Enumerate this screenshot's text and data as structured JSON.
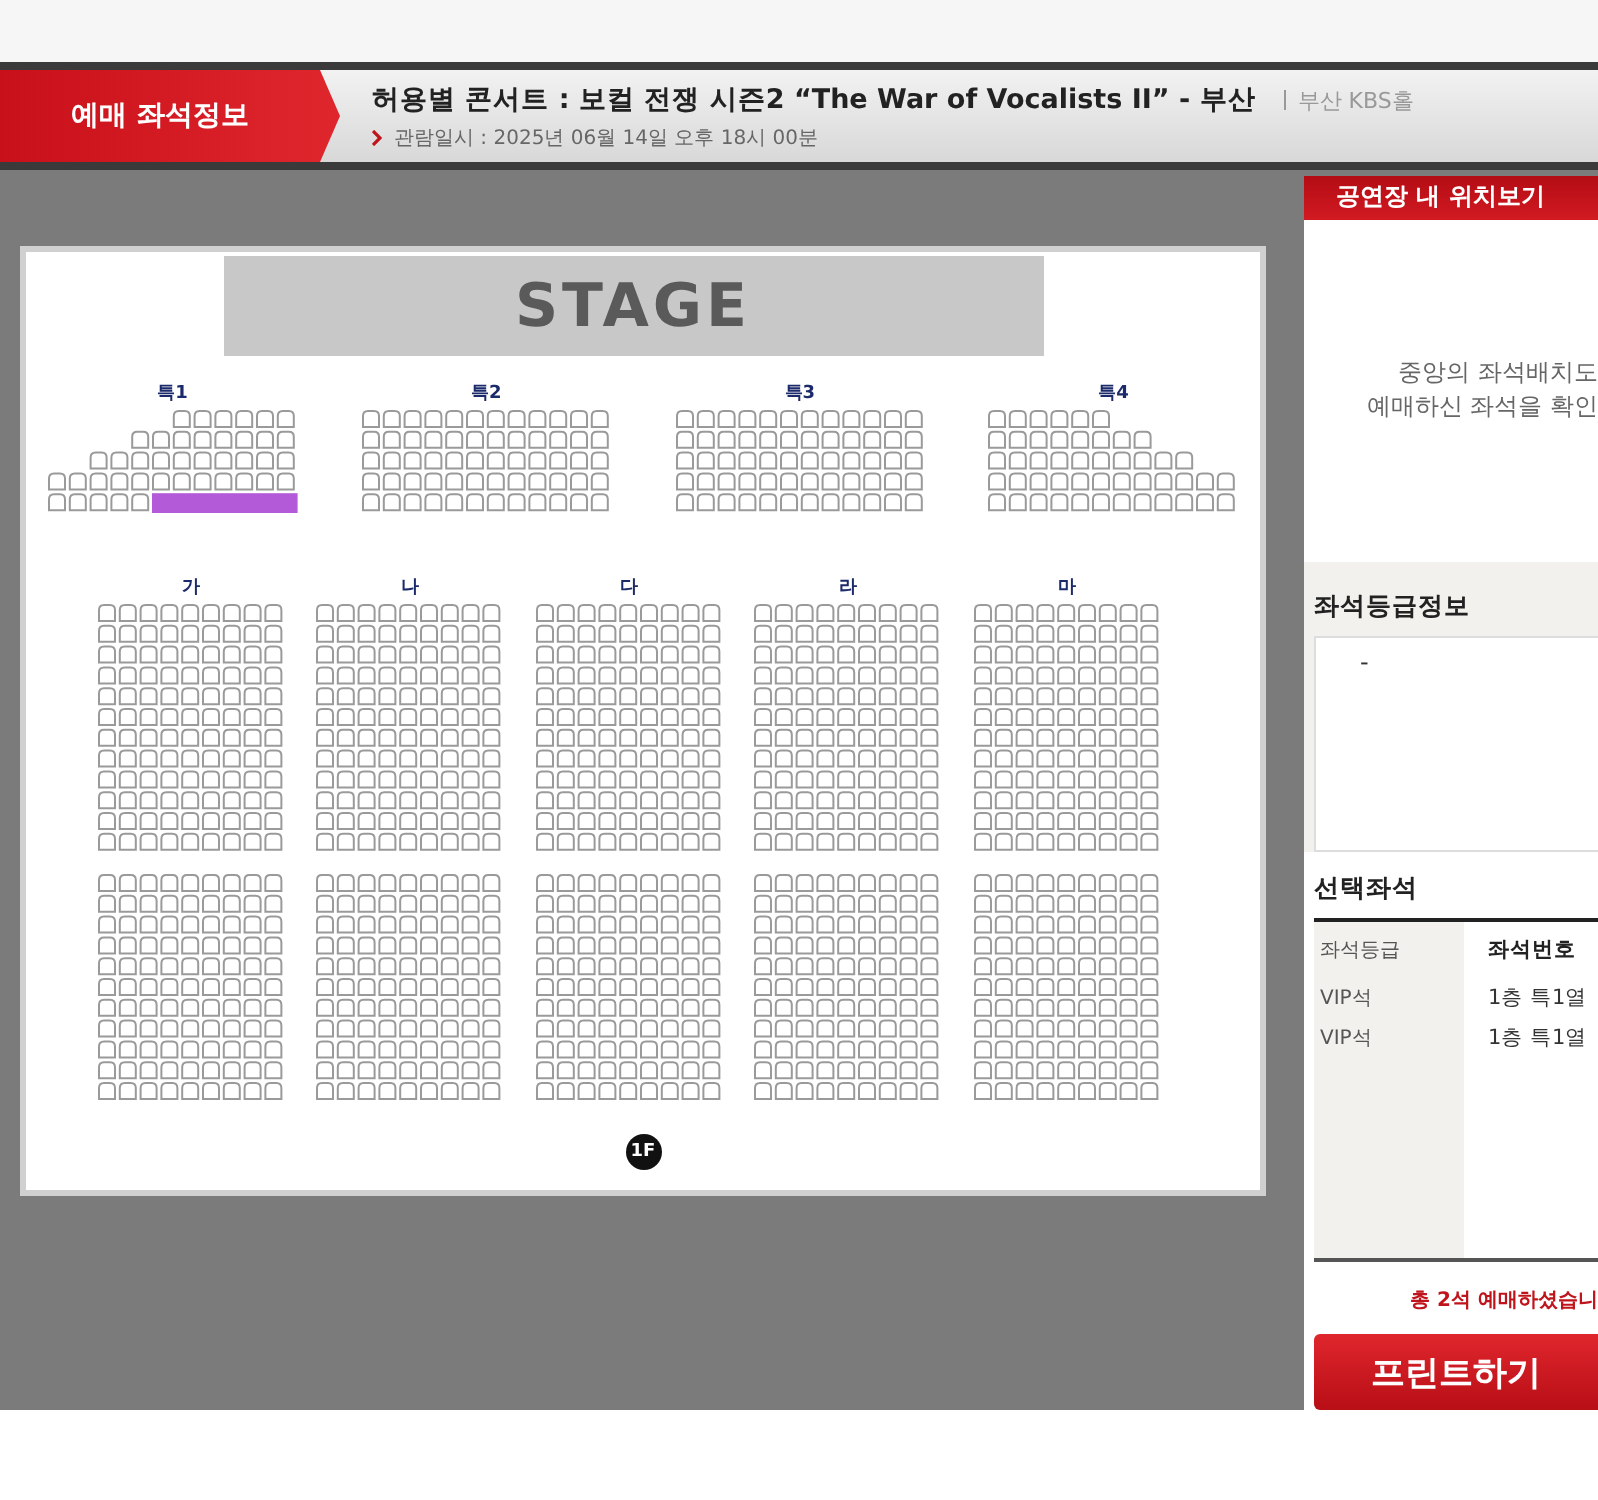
{
  "header": {
    "tab": "예매 좌석정보",
    "title": "허용별 콘서트 : 보컬 전쟁 시즌2 “The War of Vocalists II” - 부산",
    "venue": "부산 KBS홀",
    "date": "관람일시 : 2025년 06월 14일 오후 18시 00분"
  },
  "seat_map": {
    "stage": "STAGE",
    "special_sections": [
      {
        "label": "특1",
        "selected": true
      },
      {
        "label": "특2",
        "selected": false
      },
      {
        "label": "특3",
        "selected": false
      },
      {
        "label": "특4",
        "selected": false
      }
    ],
    "sections": [
      {
        "label": "가"
      },
      {
        "label": "나"
      },
      {
        "label": "다"
      },
      {
        "label": "라"
      },
      {
        "label": "마"
      }
    ],
    "floor": "1F"
  },
  "side_panel": {
    "title": "공연장 내 위치보기",
    "hint_lines": [
      "중앙의 좌석배치도",
      "예매하신 좌석을 확인"
    ],
    "grade_info": {
      "title": "좌석등급정보",
      "value": "-"
    },
    "selected_seats": {
      "title": "선택좌석",
      "columns": [
        "좌석등급",
        "좌석번호"
      ],
      "rows": [
        {
          "grade": "VIP석",
          "seat": "1층 특1열"
        },
        {
          "grade": "VIP석",
          "seat": "1층 특1열"
        }
      ]
    },
    "total": "총 2석 예매하셨습니",
    "print_button": "프린트하기"
  }
}
